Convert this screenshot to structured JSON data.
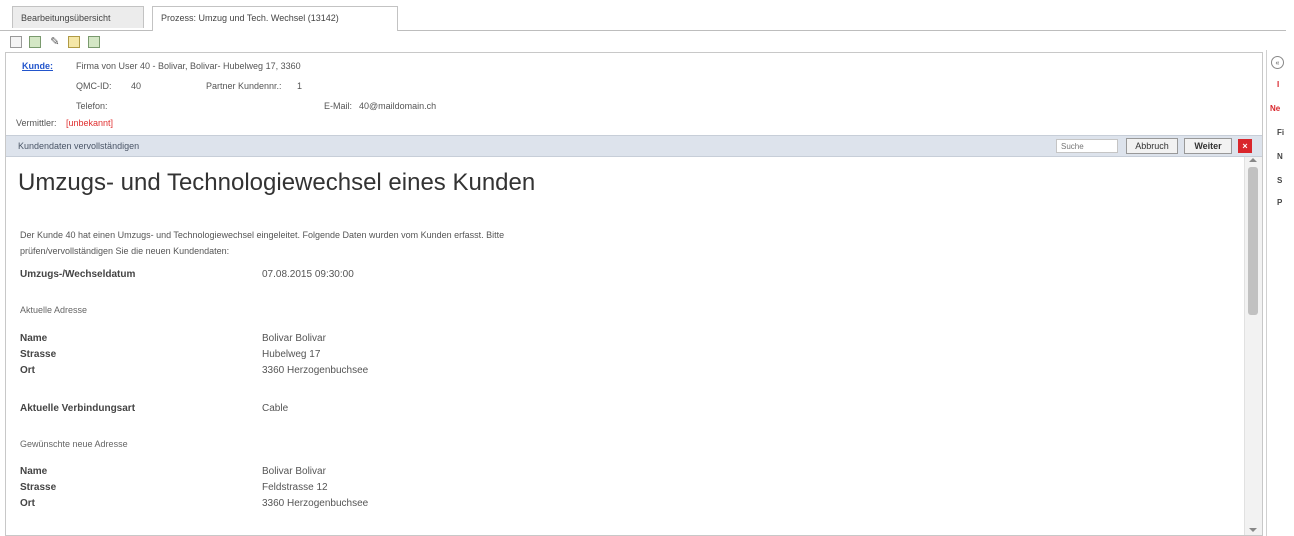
{
  "tabs": [
    "Bearbeitungsübersicht",
    "Prozess: Umzug und Tech. Wechsel (13142)"
  ],
  "toolbar": {
    "icons": [
      "document-icon",
      "save-icon",
      "pen-icon",
      "edit-icon",
      "export-icon"
    ]
  },
  "info": {
    "kunde_label": "Kunde:",
    "kunde_value": "Firma von User 40 - Bolivar, Bolivar- Hubelweg 17, 3360",
    "qmc_label": "QMC-ID:",
    "qmc_value": "40",
    "partner_label": "Partner Kundennr.:",
    "partner_value": "1",
    "telefon_label": "Telefon:",
    "email_label": "E-Mail:",
    "email_value": "40@maildomain.ch",
    "vermittler_label": "Vermittler:",
    "vermittler_value": "[unbekannt]"
  },
  "section": {
    "title": "Kundendaten vervollständigen",
    "search_placeholder": "Suche",
    "abbruch": "Abbruch",
    "weiter": "Weiter"
  },
  "main": {
    "heading": "Umzugs- und Technologiewechsel eines Kunden",
    "intro": "Der Kunde 40 hat einen Umzugs- und Technologiewechsel eingeleitet. Folgende Daten wurden vom Kunden erfasst. Bitte prüfen/vervollständigen Sie die neuen Kundendaten:",
    "datum_label": "Umzugs-/Wechseldatum",
    "datum_value": "07.08.2015 09:30:00",
    "current_address_heading": "Aktuelle Adresse",
    "name_label": "Name",
    "strasse_label": "Strasse",
    "ort_label": "Ort",
    "current": {
      "name": "Bolivar Bolivar",
      "strasse": "Hubelweg 17",
      "ort": "3360 Herzogenbuchsee"
    },
    "verbindung_label": "Aktuelle Verbindungsart",
    "verbindung_value": "Cable",
    "new_address_heading": "Gewünschte neue Adresse",
    "new": {
      "name": "Bolivar Bolivar",
      "strasse": "Feldstrasse 12",
      "ort": "3360 Herzogenbuchsee"
    }
  },
  "right_panel": {
    "items": [
      "I",
      "Ne",
      "Fi",
      "N",
      "S",
      "P"
    ]
  },
  "colors": {
    "accent_red": "#d9262c",
    "link_blue": "#2255cc",
    "section_bar": "#dde3ec"
  }
}
